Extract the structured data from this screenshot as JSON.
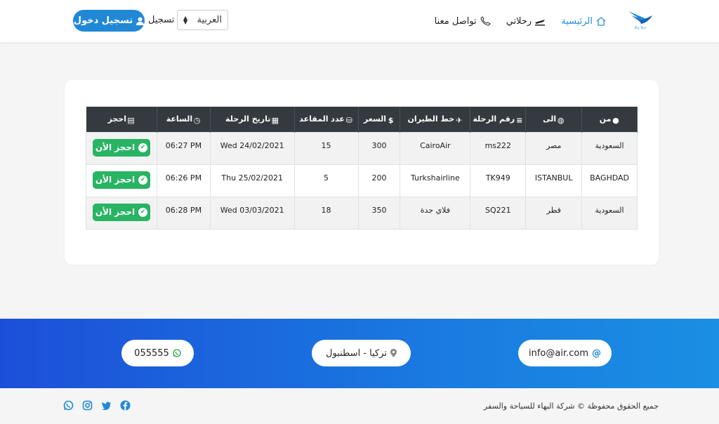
{
  "header": {
    "logo_text": "Sky Tour",
    "nav": [
      {
        "label": "الرئيسية",
        "icon": "home-icon"
      },
      {
        "label": "رحلاتي",
        "icon": "plane-icon"
      },
      {
        "label": "تواصل معنا",
        "icon": "phone-icon"
      }
    ],
    "language_value": "العربية",
    "register_label": "تسجيل",
    "login_label": "تسجيل دخول"
  },
  "table": {
    "headers": [
      "من",
      "الى",
      "رقم الرحلة",
      "خط الطيران",
      "السعر",
      "عدد المقاعد",
      "تاريخ الرحلة",
      "الساعة",
      "احجز"
    ],
    "rows": [
      {
        "from": "السعودية",
        "to": "مصر",
        "flight_no": "ms222",
        "airline": "CairoAir",
        "price": "300",
        "seats": "15",
        "date": "Wed 24/02/2021",
        "time": "06:27 PM",
        "book": "احجز الأن"
      },
      {
        "from": "BAGHDAD",
        "to": "ISTANBUL",
        "flight_no": "TK949",
        "airline": "Turkshairline",
        "price": "200",
        "seats": "5",
        "date": "Thu 25/02/2021",
        "time": "06:26 PM",
        "book": "احجز الأن"
      },
      {
        "from": "السعودية",
        "to": "قطر",
        "flight_no": "SQ221",
        "airline": "فلاي جدة",
        "price": "350",
        "seats": "18",
        "date": "Wed 03/03/2021",
        "time": "06:28 PM",
        "book": "احجز الأن"
      }
    ]
  },
  "footer": {
    "email": "info@air.com",
    "location": "تركيا - اسطنبول",
    "phone": "055555",
    "copyright": "جميع الحقوق محفوظة © شركة البهاء للسياحة والسفر",
    "social": [
      "facebook-icon",
      "twitter-icon",
      "instagram-icon",
      "whatsapp-icon"
    ]
  },
  "colors": {
    "accent": "#2188d6",
    "book": "#28b463",
    "table_header": "#343a40",
    "band_start": "#1c4fd9",
    "band_end": "#1a8fe3"
  }
}
